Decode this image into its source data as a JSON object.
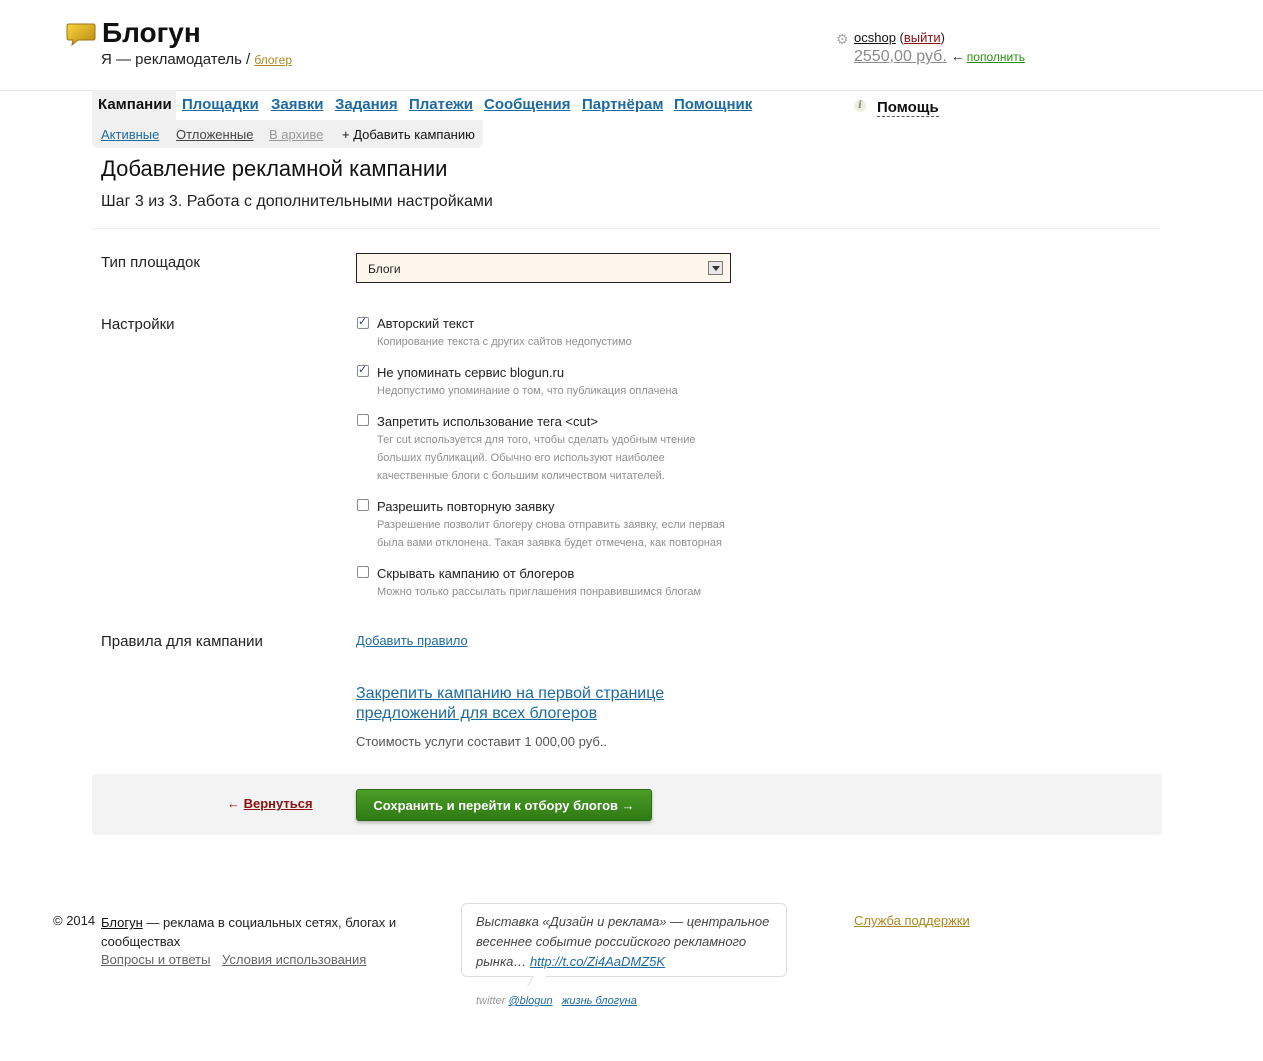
{
  "header": {
    "site_name": "Блогун",
    "role_prefix": "Я — рекламодатель /",
    "role_switch": "блогер",
    "username": "ocshop",
    "logout_open": "(",
    "logout": "выйти",
    "logout_close": ")",
    "balance": "2550,00 руб.",
    "arrow": "←",
    "topup": "пополнить"
  },
  "nav": {
    "tabs": [
      "Кампании",
      "Площадки",
      "Заявки",
      "Задания",
      "Платежи",
      "Сообщения",
      "Партнёрам",
      "Помощник"
    ],
    "subtabs": [
      "Активные",
      "Отложенные",
      "В архиве",
      "+ Добавить кампанию"
    ],
    "help": "Помощь"
  },
  "page": {
    "title": "Добавление рекламной кампании",
    "subtitle": "Шаг 3 из 3. Работа с дополнительными настройками"
  },
  "form": {
    "platform_type_label": "Тип площадок",
    "platform_type_value": "Блоги",
    "settings_label": "Настройки",
    "settings": [
      {
        "label": "Авторский текст",
        "checked": true,
        "hint": "Копирование текста с других сайтов недопустимо"
      },
      {
        "label": "Не упоминать сервис blogun.ru",
        "checked": true,
        "hint": "Недопустимо упоминание о том, что публикация оплачена"
      },
      {
        "label": "Запретить использование тега <cut>",
        "checked": false,
        "hint": "Тег cut используется для того, чтобы сделать удобным чтение больших публикаций. Обычно его используют наиболее качественные блоги с большим количеством читателей."
      },
      {
        "label": "Разрешить повторную заявку",
        "checked": false,
        "hint": "Разрешение позволит блогеру снова отправить заявку, если первая была вами отклонена. Такая заявка будет отмечена, как повторная"
      },
      {
        "label": "Скрывать кампанию от блогеров",
        "checked": false,
        "hint": "Можно только рассылать приглашения понравившимся блогам"
      }
    ],
    "rules_label": "Правила для кампании",
    "add_rule": "Добавить правило",
    "pin_link": "Закрепить кампанию на первой странице предложений для всех блогеров",
    "cost": "Стоимость услуги составит 1 000,00 руб..",
    "back_arrow": "←",
    "back": "Вернуться",
    "save": "Сохранить и перейти к отбору блогов →"
  },
  "footer": {
    "copyright": "© 2014",
    "brand": "Блогун",
    "tagline": "— реклама в социальных сетях, блогах и сообществах",
    "faq": "Вопросы и ответы",
    "terms": "Условия использования",
    "tweet_text": "Выставка «Дизайн и реклама» — центральное весеннее событие российского рекламного рынка…",
    "tweet_link": "http://t.co/Zi4AaDMZ5K",
    "twitter_prefix": "twitter",
    "twitter_handle": "@blogun",
    "blog_life": "жизнь блогуна",
    "support": "Служба поддержки"
  },
  "colors": {
    "link": "#1e6aa0",
    "accent_green": "#2f7a14",
    "logout_red": "#8b1111",
    "gold": "#a8891e"
  }
}
